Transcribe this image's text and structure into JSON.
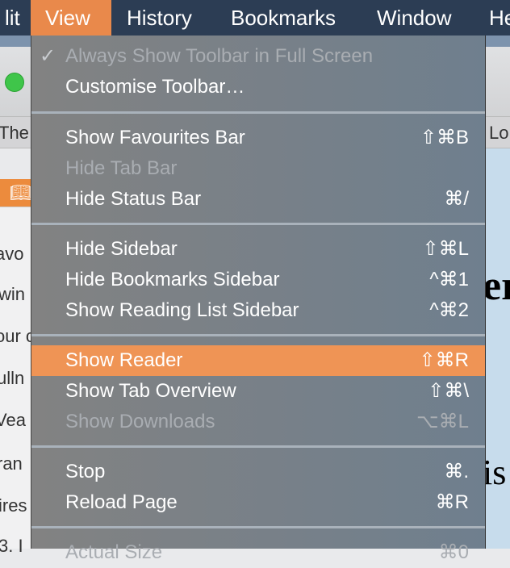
{
  "menubar": {
    "items": [
      "lit",
      "View",
      "History",
      "Bookmarks",
      "Window",
      "He"
    ],
    "active": "View"
  },
  "background": {
    "favourites_fragments": [
      "The V",
      "Lo"
    ],
    "sidebar_fragments": [
      "avo",
      "win",
      "our c",
      "ulln",
      "Vea",
      "ran",
      "ires",
      "3. I"
    ],
    "content_fragments": [
      "er",
      "is"
    ]
  },
  "view_menu": {
    "groups": [
      [
        {
          "label": "Always Show Toolbar in Full Screen",
          "shortcut": "",
          "checked": true,
          "disabled": true
        },
        {
          "label": "Customise Toolbar…",
          "shortcut": ""
        }
      ],
      [
        {
          "label": "Show Favourites Bar",
          "shortcut": "⇧⌘B"
        },
        {
          "label": "Hide Tab Bar",
          "shortcut": "",
          "disabled": true
        },
        {
          "label": "Hide Status Bar",
          "shortcut": "⌘/"
        }
      ],
      [
        {
          "label": "Hide Sidebar",
          "shortcut": "⇧⌘L"
        },
        {
          "label": "Hide Bookmarks Sidebar",
          "shortcut": "^⌘1"
        },
        {
          "label": "Show Reading List Sidebar",
          "shortcut": "^⌘2"
        }
      ],
      [
        {
          "label": "Show Reader",
          "shortcut": "⇧⌘R",
          "highlighted": true
        },
        {
          "label": "Show Tab Overview",
          "shortcut": "⇧⌘\\"
        },
        {
          "label": "Show Downloads",
          "shortcut": "⌥⌘L",
          "disabled": true
        }
      ],
      [
        {
          "label": "Stop",
          "shortcut": "⌘."
        },
        {
          "label": "Reload Page",
          "shortcut": "⌘R"
        }
      ],
      [
        {
          "label": "Actual Size",
          "shortcut": "⌘0",
          "disabled": true
        }
      ]
    ]
  },
  "colors": {
    "menubar": "#2c3d54",
    "highlight": "#ef9455",
    "active_menu": "#e9894b"
  }
}
